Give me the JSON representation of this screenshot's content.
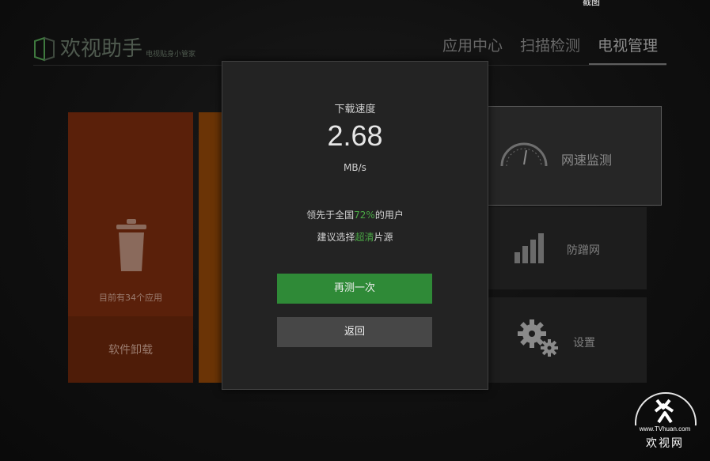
{
  "overlay": {
    "screenshot_label": "截图"
  },
  "header": {
    "app_title": "欢视助手",
    "app_subtitle": "电视贴身小管家",
    "nav": [
      {
        "label": "应用中心"
      },
      {
        "label": "扫描检测"
      },
      {
        "label": "电视管理",
        "active": true
      }
    ]
  },
  "tiles": {
    "uninstall": {
      "count_text": "目前有34个应用",
      "label": "软件卸载",
      "color": "#5a200a"
    },
    "speed": {
      "label": "网速监测",
      "icon": "speedometer-icon"
    },
    "proxy": {
      "label": "防蹭网",
      "icon": "signal-bars-icon"
    },
    "settings": {
      "label": "设置",
      "icon": "gears-icon"
    }
  },
  "dialog": {
    "title": "下载速度",
    "speed_value": "2.68",
    "speed_unit": "MB/s",
    "rank_prefix": "领先于全国",
    "rank_percent": "72%",
    "rank_suffix": "的用户",
    "suggest_prefix": "建议选择",
    "suggest_highlight": "超清",
    "suggest_suffix": "片源",
    "retry_button": "再测一次",
    "back_button": "返回",
    "accent_color": "#4aa845"
  },
  "watermark": {
    "url": "www.TVhuan.com",
    "name": "欢视网"
  }
}
